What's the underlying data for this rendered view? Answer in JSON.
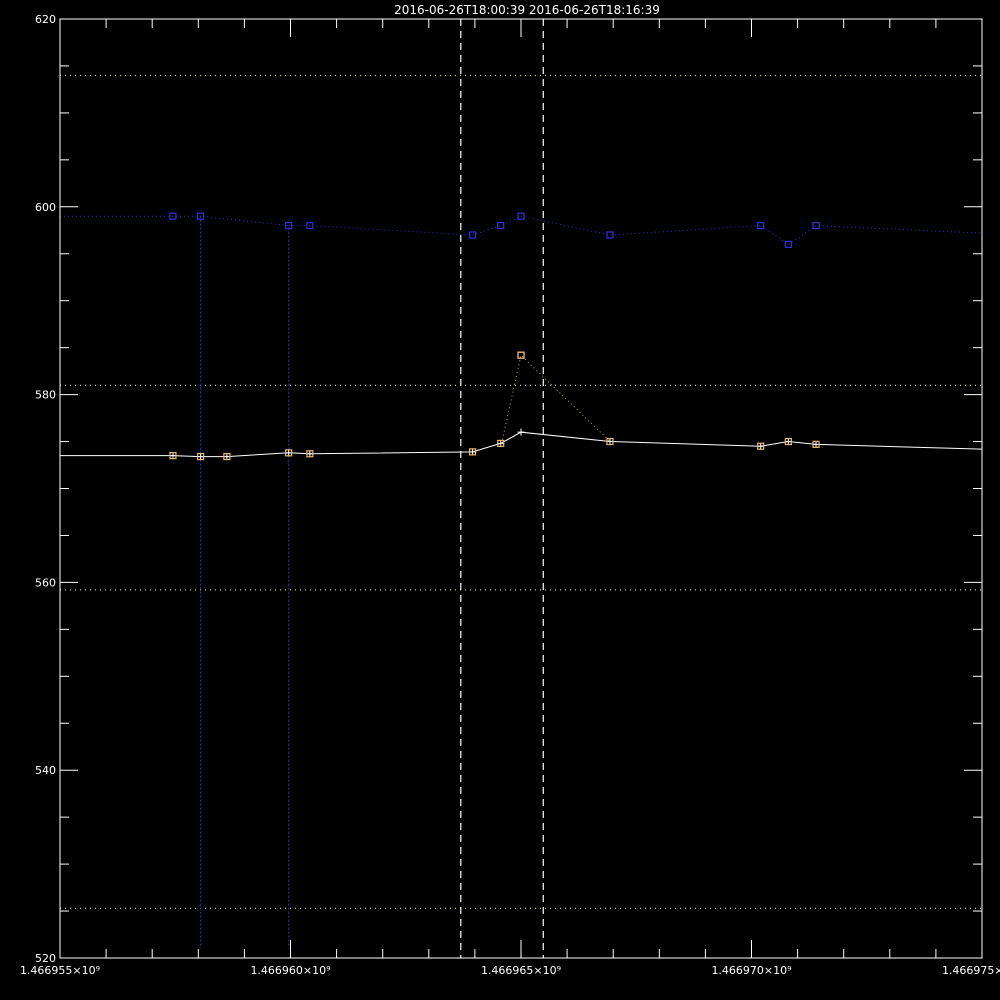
{
  "chart_data": {
    "type": "line",
    "title": "2016-06-26T18:00:39   2016-06-26T18:16:39",
    "xlabel": "",
    "ylabel": "",
    "xlim": [
      1466955000,
      1466975000
    ],
    "ylim": [
      520,
      620
    ],
    "x_ticks": [
      {
        "value": 1466955000,
        "label": "1.466955×10⁹"
      },
      {
        "value": 1466960000,
        "label": "1.466960×10⁹"
      },
      {
        "value": 1466965000,
        "label": "1.466965×10⁹"
      },
      {
        "value": 1466970000,
        "label": "1.466970×10⁹"
      },
      {
        "value": 1466975000,
        "label": "1.466975×10⁹"
      }
    ],
    "y_ticks": [
      520,
      540,
      560,
      580,
      600,
      620
    ],
    "y_minor_step": 5,
    "vertical_markers": [
      1466963694,
      1466965483
    ],
    "horizontal_reference_lines": [
      614.0,
      581.0,
      559.2,
      525.3
    ],
    "series": [
      {
        "color": "#2a35d8",
        "style": "dotted",
        "marker": "square",
        "x": [
          1466955000,
          1466957450,
          1466958050,
          1466958050,
          1466958050,
          1466959960,
          1466959960,
          1466959960,
          1466960420,
          1466963950,
          1466964560,
          1466965000,
          1466966930,
          1466970200,
          1466970800,
          1466971400,
          1466975000
        ],
        "y": [
          599,
          599,
          599,
          521,
          599,
          598,
          521,
          598,
          598,
          597,
          598,
          599,
          597,
          598,
          596,
          598,
          597.2
        ],
        "marked": [
          false,
          true,
          true,
          false,
          false,
          true,
          false,
          false,
          true,
          true,
          true,
          true,
          true,
          true,
          true,
          true,
          false
        ]
      },
      {
        "color": "#c8a070",
        "style": "dotted",
        "marker": "square",
        "x": [
          1466964580,
          1466965000,
          1466966930
        ],
        "y": [
          574.8,
          584.2,
          575.0
        ],
        "marked": [
          false,
          true,
          false
        ]
      },
      {
        "color": "#ffffff",
        "style": "solid",
        "marker": "plus",
        "x": [
          1466955000,
          1466957450,
          1466958050,
          1466958620,
          1466959960,
          1466960420,
          1466963950,
          1466964560,
          1466965000,
          1466966930,
          1466970200,
          1466970800,
          1466971400,
          1466975000
        ],
        "y": [
          573.5,
          573.5,
          573.4,
          573.4,
          573.8,
          573.7,
          573.9,
          574.8,
          576.0,
          575.0,
          574.5,
          575.0,
          574.7,
          574.2
        ],
        "marked": [
          false,
          true,
          true,
          true,
          true,
          true,
          true,
          true,
          true,
          true,
          true,
          true,
          true,
          false
        ]
      },
      {
        "color": "#e8b870",
        "style": "none",
        "marker": "square",
        "x": [
          1466957450,
          1466958050,
          1466958620,
          1466959960,
          1466960420,
          1466963950,
          1466964560,
          1466965000,
          1466966930,
          1466970200,
          1466970800,
          1466971400
        ],
        "y": [
          573.5,
          573.4,
          573.4,
          573.8,
          573.7,
          573.9,
          574.8,
          584.2,
          575.0,
          574.5,
          575.0,
          574.7
        ],
        "marked": [
          true,
          true,
          true,
          true,
          true,
          true,
          true,
          true,
          true,
          true,
          true,
          true
        ]
      }
    ]
  },
  "colors": {
    "background": "#000000",
    "axes": "#ffffff",
    "reference_lines": "#ffffa0",
    "markers": "#ffffff"
  }
}
